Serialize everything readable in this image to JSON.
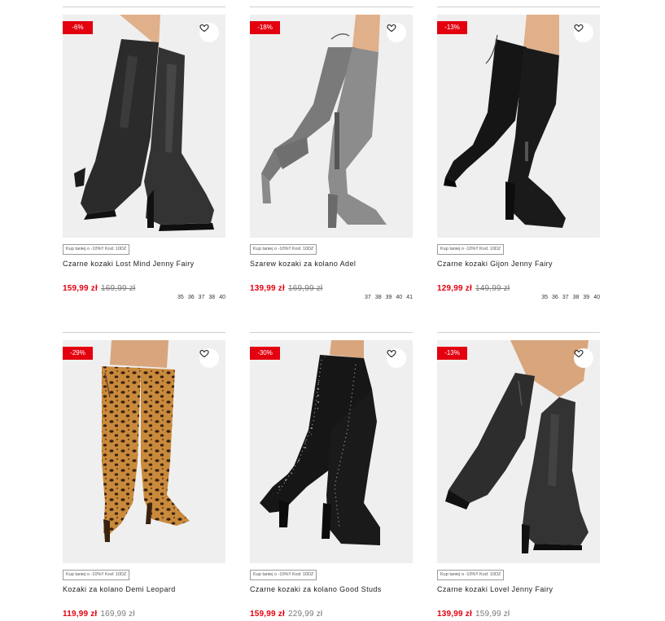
{
  "products": [
    {
      "badge": "-6%",
      "promo": "Kup taniej o -10%!! Kod: 10DZ",
      "name": "Czarne kozaki Lost Mind Jenny Fairy",
      "price": "159,99 zł",
      "old_price": "169,99 zł",
      "sizes": [
        "35",
        "36",
        "37",
        "38",
        "40"
      ],
      "image": "black-leather-knee-boots"
    },
    {
      "badge": "-18%",
      "promo": "Kup taniej o -10%!! Kod: 10DZ",
      "name": "Szarew kozaki za kolano Adel",
      "price": "139,99 zł",
      "old_price": "169,99 zł",
      "sizes": [
        "37",
        "38",
        "39",
        "40",
        "41"
      ],
      "image": "grey-suede-over-knee-boots"
    },
    {
      "badge": "-13%",
      "promo": "Kup taniej o -10%!! Kod: 10DZ",
      "name": "Czarne kozaki Gijon Jenny Fairy",
      "price": "129,99 zł",
      "old_price": "149,99 zł",
      "sizes": [
        "35",
        "36",
        "37",
        "38",
        "39",
        "40"
      ],
      "image": "black-suede-over-knee-boots"
    },
    {
      "badge": "-29%",
      "promo": "Kup taniej o -10%!! Kod: 10DZ",
      "name": "Kozaki za kolano Demi Leopard",
      "price": "119,99 zł",
      "old_price": "169,99 zł",
      "sizes": [],
      "image": "leopard-over-knee-boots"
    },
    {
      "badge": "-30%",
      "promo": "Kup taniej o -10%!! Kod: 10DZ",
      "name": "Czarne kozaki za kolano Good Studs",
      "price": "159,99 zł",
      "old_price": "229,99 zł",
      "sizes": [],
      "image": "black-studded-over-knee-boots"
    },
    {
      "badge": "-13%",
      "promo": "Kup taniej o -10%!! Kod: 10DZ",
      "name": "Czarne kozaki Lovel Jenny Fairy",
      "price": "139,99 zł",
      "old_price": "159,99 zł",
      "sizes": [],
      "image": "black-leather-block-heel-boots"
    }
  ],
  "colors": {
    "sale_red": "#e3000f",
    "image_bg": "#efefef",
    "old_price_grey": "#7a7a7a"
  },
  "icons": {
    "favorite": "heart-outline-icon"
  }
}
